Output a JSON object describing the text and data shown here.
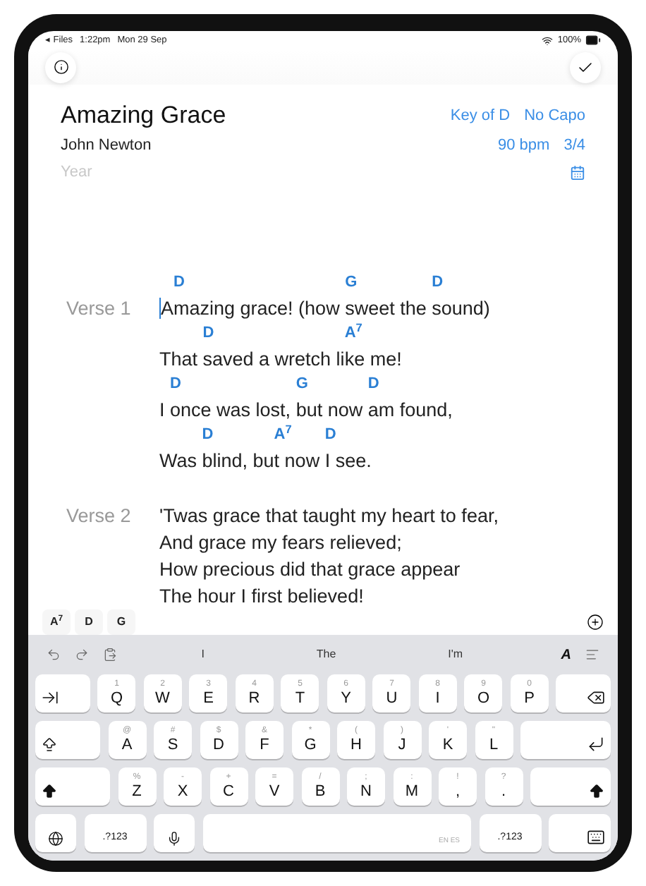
{
  "status_bar": {
    "back": "◂ Files",
    "time": "1:22pm",
    "date": "Mon 29 Sep",
    "battery": "100%"
  },
  "song": {
    "title": "Amazing Grace",
    "author": "John Newton",
    "year_placeholder": "Year",
    "key": "Key of D",
    "capo": "No Capo",
    "tempo": "90 bpm",
    "time_signature": "3/4"
  },
  "sections": [
    {
      "label": "Verse 1",
      "focused": true,
      "lines": [
        [
          {
            "text": "A"
          },
          {
            "chord": "D",
            "text": "mazing grace! (how "
          },
          {
            "chord": "G",
            "text": "sweet the "
          },
          {
            "chord": "D",
            "text": "sound)"
          }
        ],
        [
          {
            "text": "That "
          },
          {
            "chord": "D",
            "text": "saved a wretch li"
          },
          {
            "chord": "A$^{7}$",
            "text": "ke me!"
          }
        ],
        [
          {
            "text": "I "
          },
          {
            "chord": "D",
            "text": "once was lost, "
          },
          {
            "chord": "G",
            "text": "but now "
          },
          {
            "chord": "D",
            "text": "am found,"
          }
        ],
        [
          {
            "text": "Was "
          },
          {
            "chord": "D",
            "text": "blind, bu"
          },
          {
            "chord": "A$^{7}$",
            "text": "t now "
          },
          {
            "chord": "D",
            "text": "I see."
          }
        ]
      ]
    },
    {
      "label": "Verse 2",
      "focused": false,
      "lines": [
        [
          {
            "text": "'Twas grace that taught my heart to fear,"
          }
        ],
        [
          {
            "text": "And grace my fears relieved;"
          }
        ],
        [
          {
            "text": "How precious did that grace appear"
          }
        ],
        [
          {
            "text": "The hour I first believed!"
          }
        ]
      ]
    }
  ],
  "chord_palette": [
    "A$^{7}$",
    "D",
    "G"
  ],
  "keyboard": {
    "suggestions": [
      "I",
      "The",
      "I'm"
    ],
    "format_button": "A",
    "rows": [
      {
        "keys": [
          {
            "kind": "tab"
          },
          {
            "kind": "char",
            "label": "Q",
            "alt": "1"
          },
          {
            "kind": "char",
            "label": "W",
            "alt": "2"
          },
          {
            "kind": "char",
            "label": "E",
            "alt": "3"
          },
          {
            "kind": "char",
            "label": "R",
            "alt": "4"
          },
          {
            "kind": "char",
            "label": "T",
            "alt": "5"
          },
          {
            "kind": "char",
            "label": "Y",
            "alt": "6"
          },
          {
            "kind": "char",
            "label": "U",
            "alt": "7"
          },
          {
            "kind": "char",
            "label": "I",
            "alt": "8"
          },
          {
            "kind": "char",
            "label": "O",
            "alt": "9"
          },
          {
            "kind": "char",
            "label": "P",
            "alt": "0"
          },
          {
            "kind": "delete"
          }
        ]
      },
      {
        "keys": [
          {
            "kind": "caps"
          },
          {
            "kind": "char",
            "label": "A",
            "alt": "@"
          },
          {
            "kind": "char",
            "label": "S",
            "alt": "#"
          },
          {
            "kind": "char",
            "label": "D",
            "alt": "$"
          },
          {
            "kind": "char",
            "label": "F",
            "alt": "&"
          },
          {
            "kind": "char",
            "label": "G",
            "alt": "*"
          },
          {
            "kind": "char",
            "label": "H",
            "alt": "("
          },
          {
            "kind": "char",
            "label": "J",
            "alt": ")"
          },
          {
            "kind": "char",
            "label": "K",
            "alt": "'"
          },
          {
            "kind": "char",
            "label": "L",
            "alt": "\""
          },
          {
            "kind": "return"
          }
        ]
      },
      {
        "keys": [
          {
            "kind": "shift"
          },
          {
            "kind": "char",
            "label": "Z",
            "alt": "%"
          },
          {
            "kind": "char",
            "label": "X",
            "alt": "-"
          },
          {
            "kind": "char",
            "label": "C",
            "alt": "+"
          },
          {
            "kind": "char",
            "label": "V",
            "alt": "="
          },
          {
            "kind": "char",
            "label": "B",
            "alt": "/"
          },
          {
            "kind": "char",
            "label": "N",
            "alt": ";"
          },
          {
            "kind": "char",
            "label": "M",
            "alt": ":"
          },
          {
            "kind": "char",
            "label": ",",
            "alt": "!"
          },
          {
            "kind": "char",
            "label": ".",
            "alt": "?"
          },
          {
            "kind": "shift"
          }
        ]
      },
      {
        "keys": [
          {
            "kind": "globe"
          },
          {
            "kind": "text",
            "label": ".?123"
          },
          {
            "kind": "mic"
          },
          {
            "kind": "space",
            "label": "EN ES"
          },
          {
            "kind": "text",
            "label": ".?123"
          },
          {
            "kind": "dismiss"
          }
        ]
      }
    ]
  }
}
